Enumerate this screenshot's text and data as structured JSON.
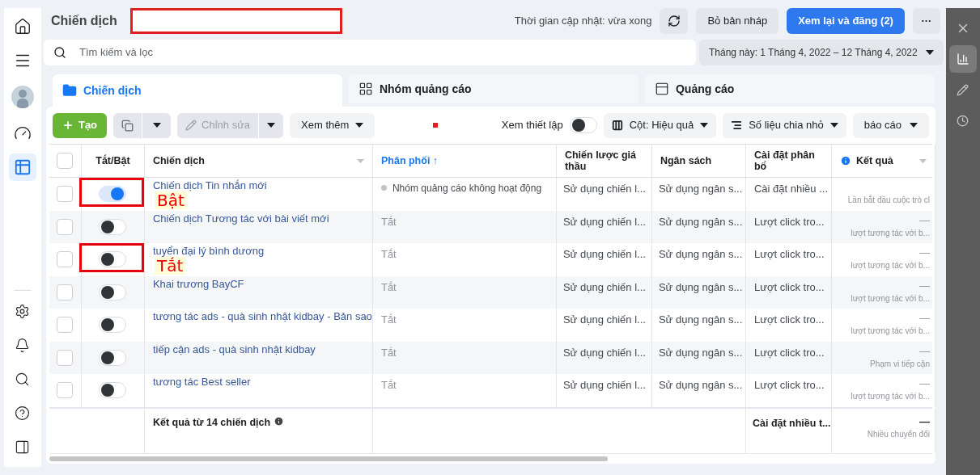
{
  "sidebar": {
    "top": [
      {
        "kind": "home",
        "selected": false
      },
      {
        "kind": "menu",
        "selected": false
      }
    ],
    "bottom_top": [
      {
        "kind": "gauge",
        "selected": false
      },
      {
        "kind": "table",
        "selected": true
      }
    ],
    "bottom": [
      {
        "kind": "settings",
        "selected": false
      },
      {
        "kind": "bell",
        "selected": false
      },
      {
        "kind": "search",
        "selected": false
      },
      {
        "kind": "help",
        "selected": false
      },
      {
        "kind": "panel",
        "selected": false
      }
    ]
  },
  "header": {
    "title": "Chiến dịch",
    "update_time": "Thời gian cập nhật: vừa xong",
    "discard": "Bỏ bản nháp",
    "publish": "Xem lại và đăng (2)",
    "more": "···"
  },
  "search": {
    "placeholder": "Tìm kiếm và lọc"
  },
  "date_range": "Tháng này: 1 Tháng 4, 2022 – 12 Tháng 4, 2022",
  "tabs": [
    {
      "label": "Chiến dịch",
      "kind": "campaign",
      "selected": true
    },
    {
      "label": "Nhóm quảng cáo",
      "kind": "adset",
      "selected": false
    },
    {
      "label": "Quảng cáo",
      "kind": "ad",
      "selected": false
    }
  ],
  "toolbar": {
    "create": "Tạo",
    "edit": "Chỉnh sửa",
    "edit_disabled": true,
    "more": "Xem thêm",
    "view_setup": "Xem thiết lập",
    "view_setup_on": false,
    "columns": "Cột: Hiệu quả",
    "breakdown": "Số liệu chia nhỏ",
    "reports": "báo cáo"
  },
  "table": {
    "all_checked": false,
    "columns": [
      "Tắt/Bật",
      "Chiến dịch",
      "Phân phối",
      "Chiến lược giá thầu",
      "Ngân sách",
      "Cài đặt phân bổ",
      "Kết quả"
    ],
    "sorted_column_arrow": "↑",
    "rows": [
      {
        "checked": false,
        "on": true,
        "name": "Chiến dịch Tin nhắn mới",
        "delivery": "Nhóm quảng cáo không hoạt động",
        "delivery_dot": true,
        "bid": "Sử dụng chiến l...",
        "budget": "Sử dụng ngân s...",
        "allocation": "Cài đặt nhiều ...",
        "result_note": "Lần bắt đầu cuộc trò cl",
        "annotation": "Bật"
      },
      {
        "checked": false,
        "on": false,
        "name": "Chiến dịch Tương tác với bài viết mới",
        "delivery": "Tắt",
        "delivery_dot": false,
        "bid": "Sử dụng chiến l...",
        "budget": "Sử dụng ngân s...",
        "allocation": "Lượt click tro...",
        "result": "—",
        "result_note": "lượt tương tác với b..."
      },
      {
        "checked": false,
        "on": false,
        "name": "tuyển đại lý bình dương",
        "delivery": "Tắt",
        "delivery_dot": false,
        "bid": "Sử dụng chiến l...",
        "budget": "Sử dụng ngân s...",
        "allocation": "Lượt click tro...",
        "result": "—",
        "result_note": "lượt tương tác với b...",
        "annotation": "Tắt"
      },
      {
        "checked": false,
        "on": false,
        "name": "Khai trương BayCF",
        "delivery": "Tắt",
        "delivery_dot": false,
        "bid": "Sử dụng chiến l...",
        "budget": "Sử dụng ngân s...",
        "allocation": "Lượt click tro...",
        "result": "—",
        "result_note": "lượt tương tác với b..."
      },
      {
        "checked": false,
        "on": false,
        "name": "tương tác ads - quà sinh nhật kidbay - Bản sao",
        "delivery": "Tắt",
        "delivery_dot": false,
        "bid": "Sử dụng chiến l...",
        "budget": "Sử dụng ngân s...",
        "allocation": "Lượt click tro...",
        "result": "—",
        "result_note": "lượt tương tác với b..."
      },
      {
        "checked": false,
        "on": false,
        "name": "tiếp cận ads - quà sinh nhật kidbay",
        "delivery": "Tắt",
        "delivery_dot": false,
        "bid": "Sử dụng chiến l...",
        "budget": "Sử dụng ngân s...",
        "allocation": "Lượt click tro...",
        "result": "—",
        "result_note": "Phạm vi tiếp cận"
      },
      {
        "checked": false,
        "on": false,
        "name": "tương tác Best seller",
        "delivery": "Tắt",
        "delivery_dot": false,
        "bid": "Sử dụng chiến l...",
        "budget": "Sử dụng ngân s...",
        "allocation": "Lượt click tro...",
        "result": "—",
        "result_note": "lượt tương tác với b..."
      }
    ],
    "footer": {
      "summary": "Kết quả từ 14 chiến dịch",
      "allocation": "Cài đặt nhiều t...",
      "result": "—",
      "result_note": "Nhiều chuyển đổi"
    }
  },
  "right_panel": [
    {
      "kind": "close",
      "selected": false
    },
    {
      "kind": "chart",
      "selected": true
    },
    {
      "kind": "pencil",
      "selected": false
    },
    {
      "kind": "clock",
      "selected": false
    }
  ]
}
